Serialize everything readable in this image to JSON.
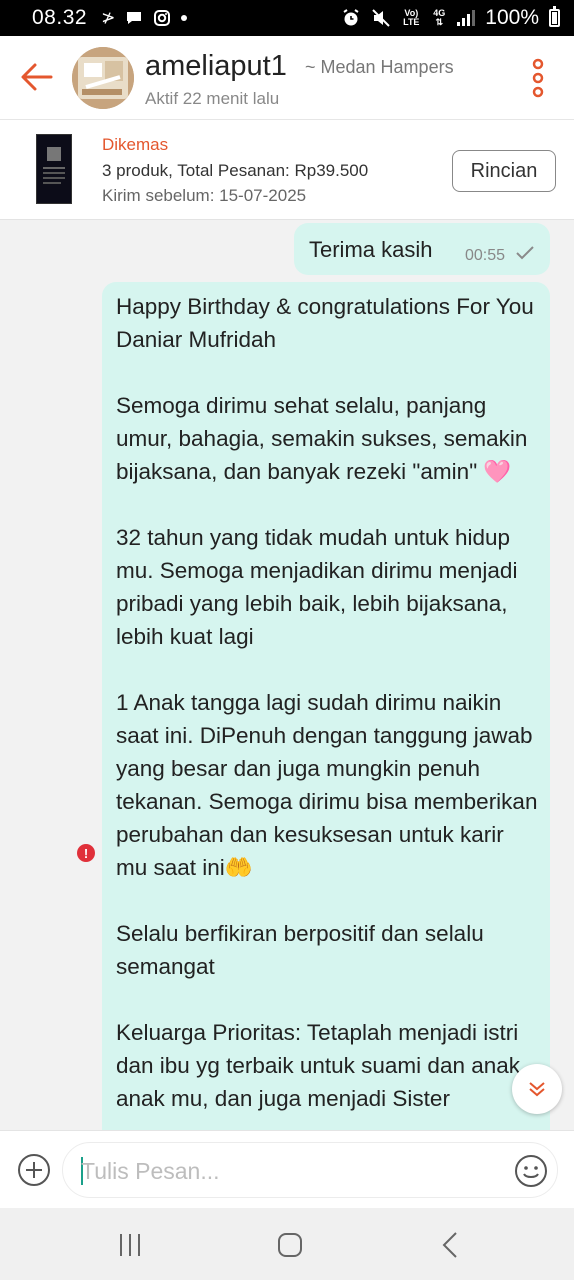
{
  "status_bar": {
    "time": "08.32",
    "battery": "100%",
    "network_label": "4G",
    "lte_label": "Vo) LTE",
    "icons": [
      "data-transfer-icon",
      "chat-bubble-icon",
      "instagram-icon",
      "dot-icon",
      "alarm-icon",
      "mute-icon",
      "signal-icon",
      "battery-icon"
    ]
  },
  "header": {
    "shop_name": "ameliaput1",
    "shop_subtitle": "~ Medan Hampers",
    "last_active": "Aktif 22 menit lalu"
  },
  "order": {
    "status": "Dikemas",
    "summary": "3 produk, Total Pesanan: Rp39.500",
    "deadline": "Kirim sebelum: 15-07-2025",
    "details_button": "Rincian"
  },
  "messages": [
    {
      "text": "Terima kasih",
      "time": "00:55",
      "status": "sent"
    },
    {
      "text": "Happy Birthday & congratulations For You Daniar Mufridah\n\nSemoga dirimu sehat selalu, panjang umur, bahagia, semakin sukses, semakin bijaksana, dan banyak rezeki \"amin\" 🩷\n\n32 tahun yang tidak mudah untuk hidup mu. Semoga menjadikan dirimu menjadi pribadi yang lebih baik, lebih bijaksana, lebih kuat lagi\n\n1 Anak tangga lagi sudah dirimu naikin saat ini. DiPenuh dengan tanggung jawab yang besar dan juga mungkin penuh tekanan. Semoga dirimu bisa memberikan perubahan dan kesuksesan untuk karir mu saat ini🤲\n\nSelalu berfikiran berpositif dan selalu semangat\n\nKeluarga Prioritas: Tetaplah menjadi istri dan ibu yg terbaik untuk suami dan anak anak mu, dan juga menjadi Sister",
      "status": "failed"
    }
  ],
  "input": {
    "placeholder": "Tulis Pesan..."
  },
  "colors": {
    "accent": "#e4572e",
    "bubble": "#d6f5ef",
    "error": "#e0303a"
  }
}
